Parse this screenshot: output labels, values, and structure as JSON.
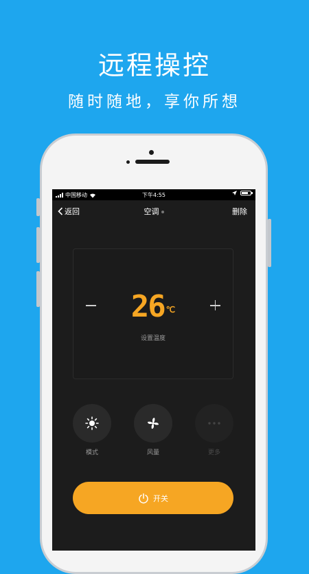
{
  "promo": {
    "title": "远程操控",
    "subtitle": "随时随地，享你所想"
  },
  "statusbar": {
    "carrier": "中国移动",
    "time": "下午4:55"
  },
  "nav": {
    "back_label": "返回",
    "title": "空调",
    "delete_label": "删除"
  },
  "temperature": {
    "value": "26",
    "unit": "℃",
    "label": "设置温度"
  },
  "controls": [
    {
      "label": "模式",
      "icon": "sun-icon"
    },
    {
      "label": "风量",
      "icon": "fan-icon"
    },
    {
      "label": "更多",
      "icon": "more-icon"
    }
  ],
  "power": {
    "label": "开关",
    "icon": "power-icon"
  },
  "colors": {
    "background": "#1ea6ee",
    "accent": "#f6a623",
    "screen": "#1c1c1c"
  }
}
